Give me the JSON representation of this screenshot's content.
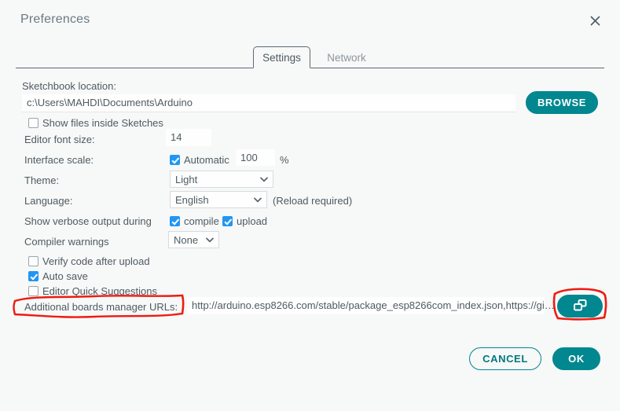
{
  "dialog": {
    "title": "Preferences",
    "close_icon": "close-icon"
  },
  "tabs": [
    {
      "label": "Settings",
      "active": true
    },
    {
      "label": "Network",
      "active": false
    }
  ],
  "settings": {
    "sketchbook": {
      "label": "Sketchbook location:",
      "value": "c:\\Users\\MAHDI\\Documents\\Arduino",
      "browse_label": "BROWSE"
    },
    "show_files_inside_sketches": {
      "label": "Show files inside Sketches",
      "checked": false
    },
    "editor_font_size": {
      "label": "Editor font size:",
      "value": "14"
    },
    "interface_scale": {
      "label": "Interface scale:",
      "automatic_label": "Automatic",
      "automatic_checked": true,
      "value": "100",
      "unit": "%"
    },
    "theme": {
      "label": "Theme:",
      "value": "Light",
      "options": [
        "Light"
      ]
    },
    "language": {
      "label": "Language:",
      "value": "English",
      "options": [
        "English"
      ],
      "note": "(Reload required)"
    },
    "verbose_output": {
      "label": "Show verbose output during",
      "compile_label": "compile",
      "compile_checked": true,
      "upload_label": "upload",
      "upload_checked": true
    },
    "compiler_warnings": {
      "label": "Compiler warnings",
      "value": "None",
      "options": [
        "None"
      ]
    },
    "verify_code_after_upload": {
      "label": "Verify code after upload",
      "checked": false
    },
    "auto_save": {
      "label": "Auto save",
      "checked": true
    },
    "editor_quick_suggestions": {
      "label": "Editor Quick Suggestions",
      "checked": false
    },
    "additional_urls": {
      "label": "Additional boards manager URLs:",
      "value": "http://arduino.esp8266.com/stable/package_esp8266com_index.json,https://gi…",
      "edit_icon": "open-windows-icon"
    }
  },
  "footer": {
    "cancel_label": "CANCEL",
    "ok_label": "OK"
  },
  "colors": {
    "accent_teal": "#00878f",
    "checkbox_blue": "#2196f3",
    "annotation_red": "#ee1b11",
    "background": "#f7f8f8",
    "text": "#4e5b61"
  },
  "annotation": {
    "shape": "hand-drawn-rectangle",
    "target": "Additional boards manager URLs:"
  }
}
